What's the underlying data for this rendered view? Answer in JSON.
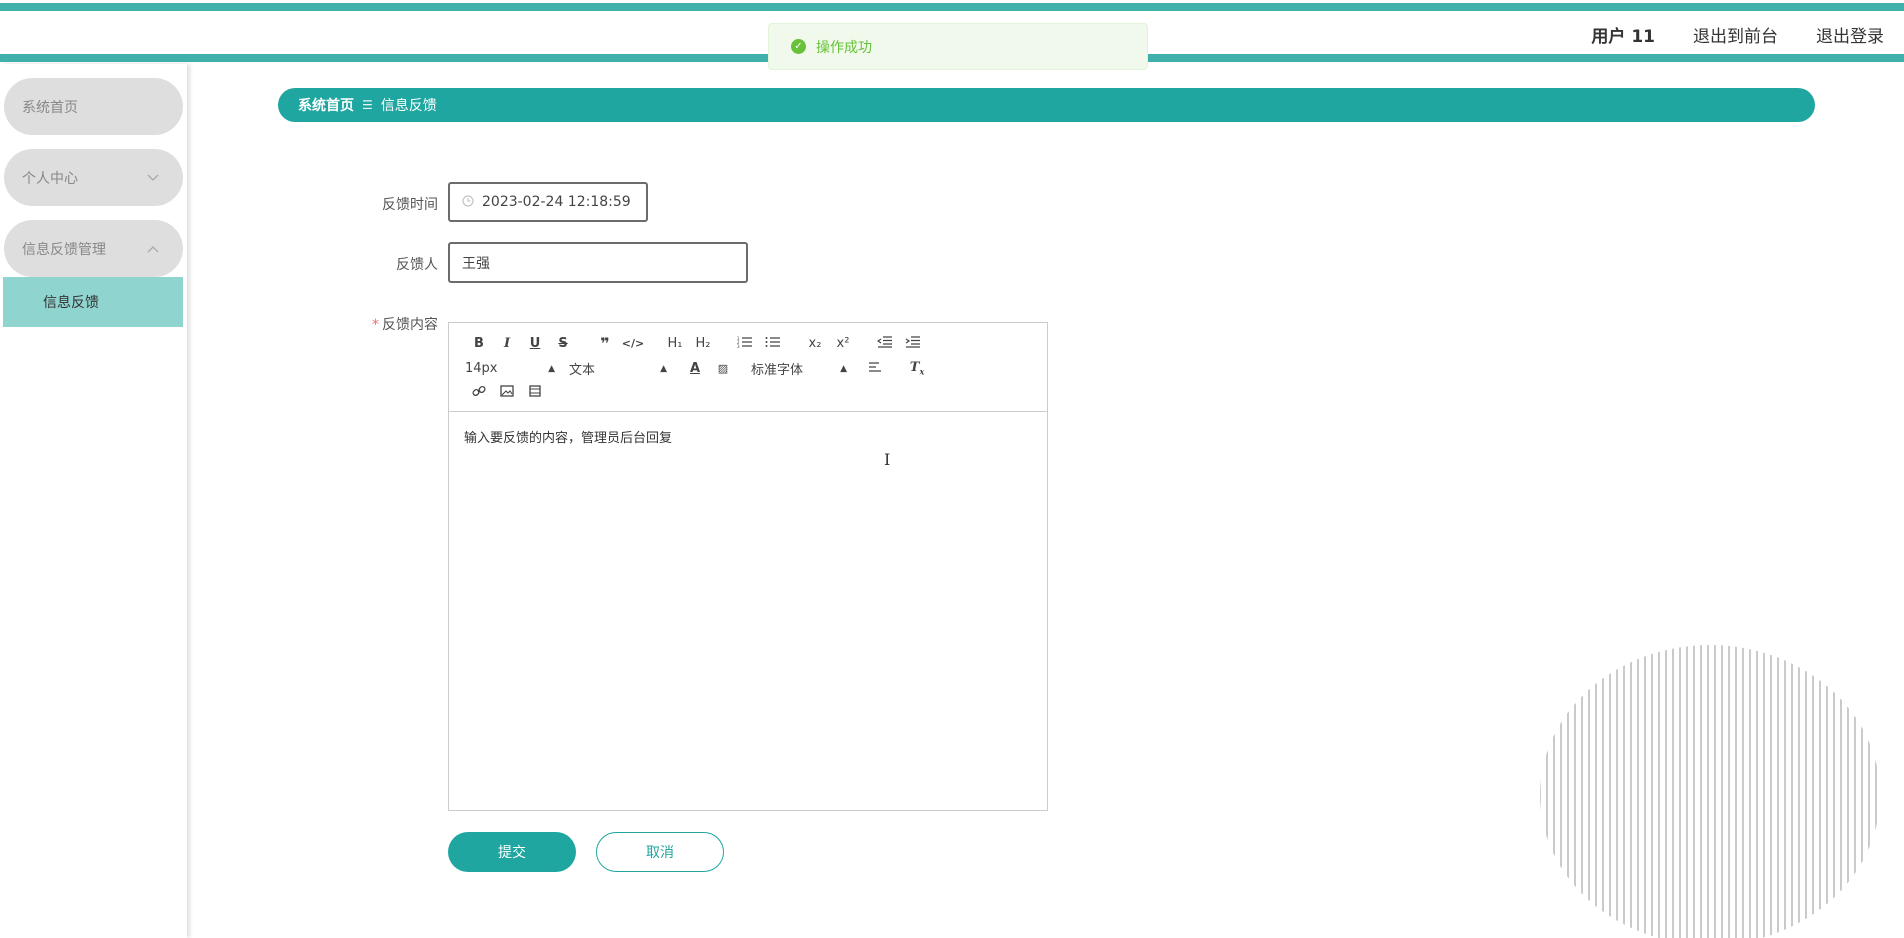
{
  "header": {
    "user": "用户 11",
    "back_to_front": "退出到前台",
    "logout": "退出登录"
  },
  "toast": {
    "message": "操作成功",
    "icon": "check-circle-icon",
    "color": "#67c23a"
  },
  "sidebar": {
    "items": [
      {
        "label": "系统首页"
      },
      {
        "label": "个人中心",
        "icon": "chevron-down-icon"
      },
      {
        "label": "信息反馈管理",
        "icon": "chevron-up-icon",
        "children": [
          {
            "label": "信息反馈"
          }
        ]
      }
    ]
  },
  "breadcrumb": {
    "home": "系统首页",
    "separator": "☰",
    "current": "信息反馈"
  },
  "form": {
    "time_label": "反馈时间",
    "time_value": "2023-02-24 12:18:59",
    "person_label": "反馈人",
    "person_value": "王强",
    "content_label": "反馈内容",
    "required_mark": "*",
    "editor": {
      "font_size": "14px",
      "text_type": "文本",
      "font_family": "标准字体",
      "placeholder": "输入要反馈的内容，管理员后台回复"
    },
    "submit_label": "提交",
    "cancel_label": "取消"
  },
  "colors": {
    "accent": "#1fa6a0",
    "stripe": "#3fb0aa",
    "sidebar_active": "#8fd4cf"
  }
}
